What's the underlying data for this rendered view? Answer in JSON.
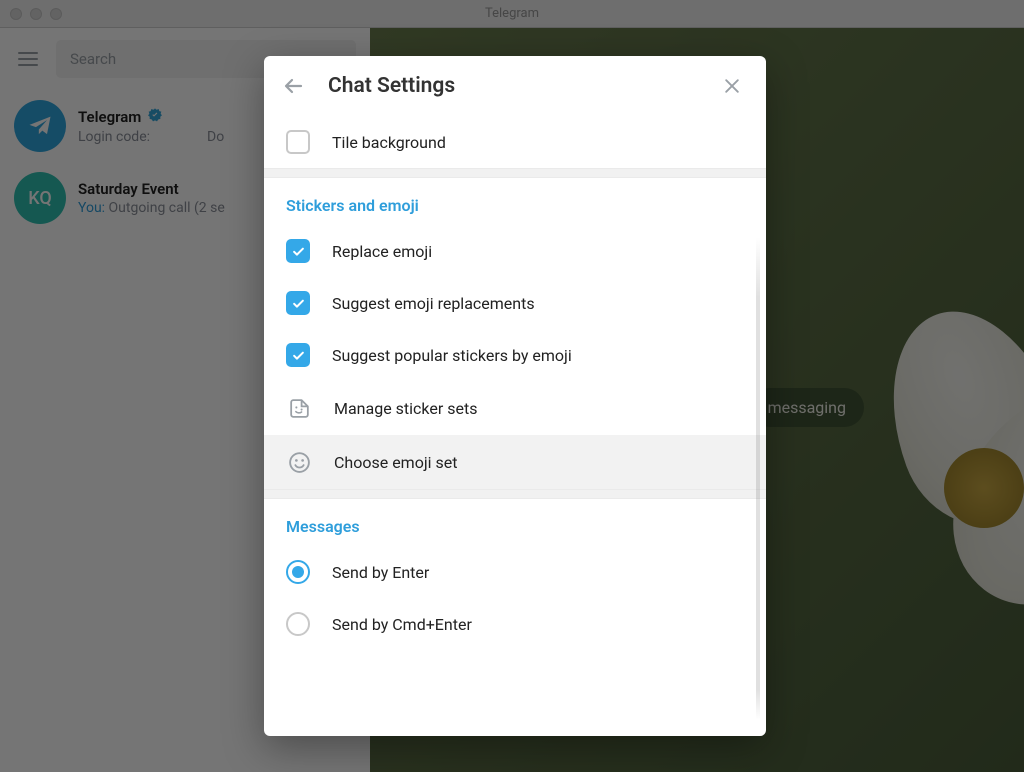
{
  "window": {
    "title": "Telegram"
  },
  "sidebar": {
    "search_placeholder": "Search",
    "chats": [
      {
        "name": "Telegram",
        "subtitle_left": "Login code:",
        "subtitle_right": "Do",
        "avatar": "telegram"
      },
      {
        "name": "Saturday Event",
        "subtitle_you": "You:",
        "subtitle_rest": " Outgoing call (2 se",
        "avatar_initials": "KQ"
      }
    ]
  },
  "chatarea": {
    "bubble_partial": "messaging"
  },
  "modal": {
    "title": "Chat Settings",
    "tile_background": {
      "label": "Tile background",
      "checked": false
    },
    "sections": {
      "stickers": {
        "heading": "Stickers and emoji",
        "items": [
          {
            "key": "replace-emoji",
            "label": "Replace emoji",
            "type": "checkbox",
            "checked": true
          },
          {
            "key": "suggest-emoji",
            "label": "Suggest emoji replacements",
            "type": "checkbox",
            "checked": true
          },
          {
            "key": "suggest-stickers",
            "label": "Suggest popular stickers by emoji",
            "type": "checkbox",
            "checked": true
          },
          {
            "key": "manage-stickers",
            "label": "Manage sticker sets",
            "type": "link",
            "icon": "sticker"
          },
          {
            "key": "choose-emoji",
            "label": "Choose emoji set",
            "type": "link",
            "icon": "emoji",
            "highlighted": true
          }
        ]
      },
      "messages": {
        "heading": "Messages",
        "items": [
          {
            "key": "send-enter",
            "label": "Send by Enter",
            "type": "radio",
            "selected": true
          },
          {
            "key": "send-cmd-enter",
            "label": "Send by Cmd+Enter",
            "type": "radio",
            "selected": false
          }
        ]
      }
    }
  }
}
